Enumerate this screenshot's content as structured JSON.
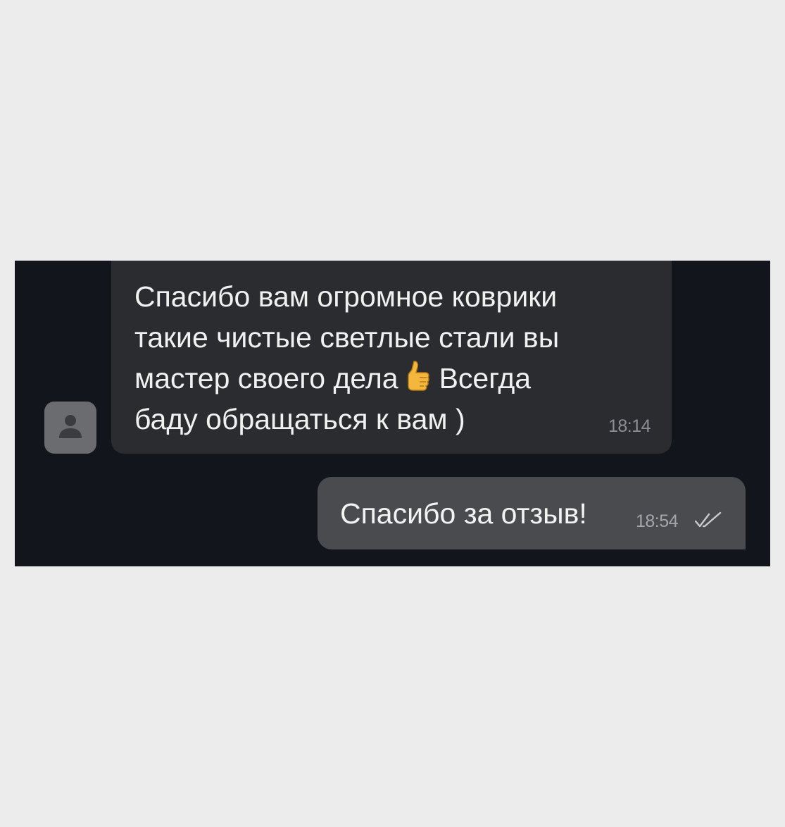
{
  "chat": {
    "incoming": {
      "lines": [
        "Спасибо вам огромное коврики",
        "такие чистые светлые стали вы",
        "мастер своего дела",
        "Всегда",
        "баду обращаться к вам )"
      ],
      "emoji": "thumbs-up",
      "time": "18:14"
    },
    "outgoing": {
      "text": "Спасибо за отзыв!",
      "time": "18:54",
      "status_icon": "double-check-icon"
    }
  },
  "colors": {
    "page_background": "#ececec",
    "chat_background": "#12151b",
    "incoming_bubble": "#2b2c30",
    "outgoing_bubble": "#4a4b4f",
    "avatar": "#6b6c70",
    "message_text": "#f1f1f1",
    "timestamp": "#8c8e94"
  }
}
